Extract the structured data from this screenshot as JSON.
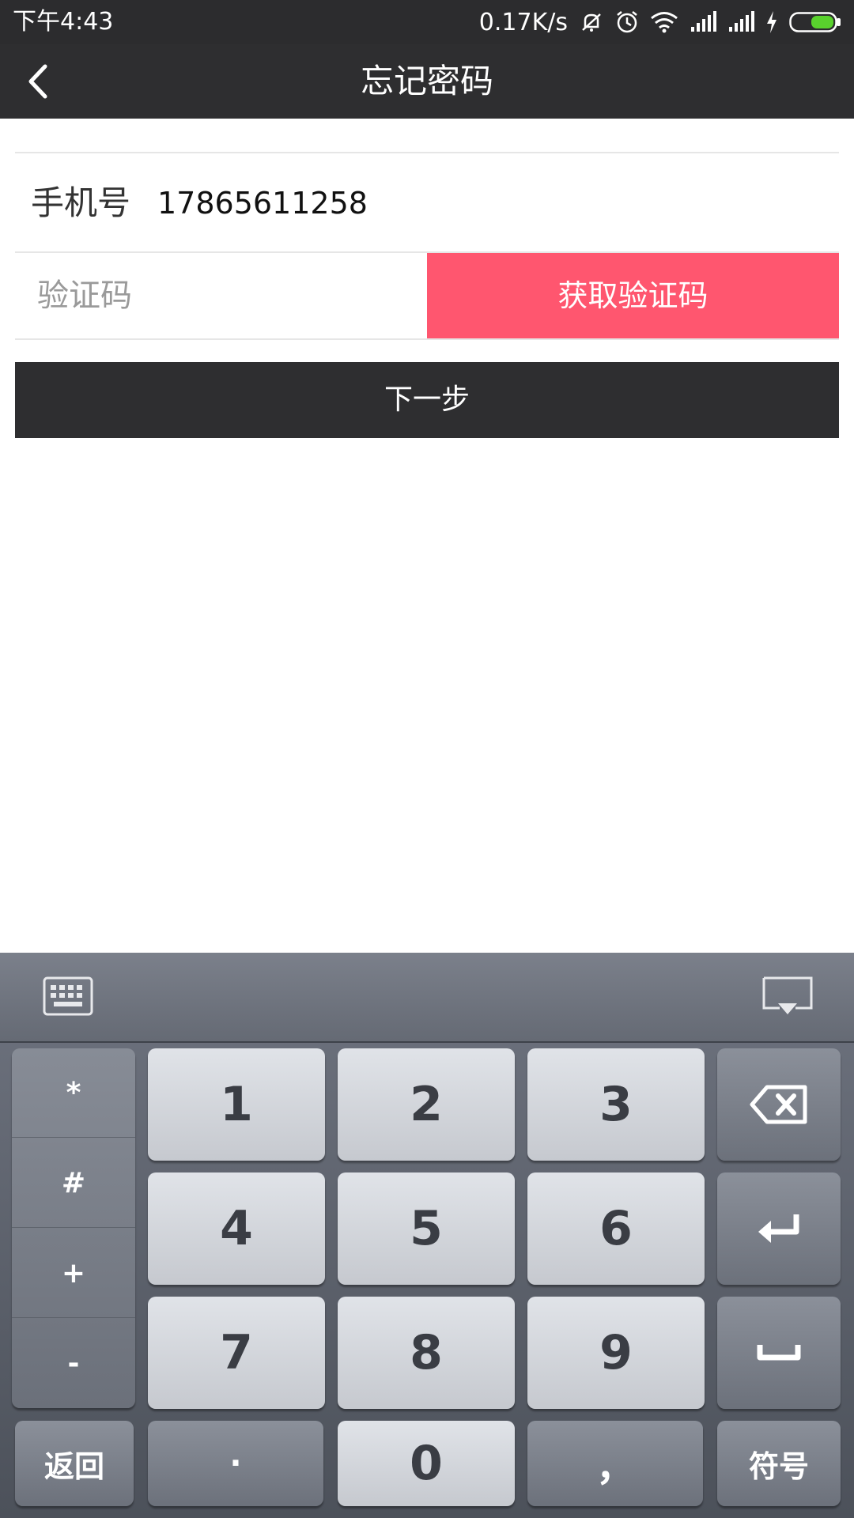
{
  "status_bar": {
    "time": "下午4:43",
    "net_speed": "0.17K/s",
    "icons": [
      "mute-icon",
      "alarm-icon",
      "wifi-icon",
      "signal-icon",
      "signal-icon",
      "charging-icon",
      "battery-icon"
    ]
  },
  "header": {
    "title": "忘记密码"
  },
  "form": {
    "phone_label": "手机号",
    "phone_value": "17865611258",
    "code_placeholder": "验证码",
    "get_code_label": "获取验证码",
    "next_label": "下一步"
  },
  "keyboard": {
    "symbols": [
      "*",
      "#",
      "+",
      "-"
    ],
    "digits": [
      "1",
      "2",
      "3",
      "4",
      "5",
      "6",
      "7",
      "8",
      "9",
      "0"
    ],
    "dot": "·",
    "comma": "，",
    "back_label": "返回",
    "symbol_label": "符号"
  },
  "colors": {
    "accent": "#ff566f",
    "bar": "#2e2e30"
  }
}
